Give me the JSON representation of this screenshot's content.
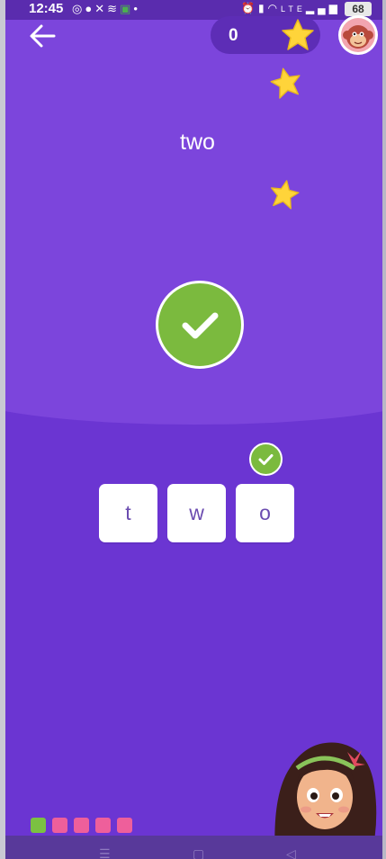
{
  "status_bar": {
    "time": "12:45",
    "left_icons": [
      "whatsapp-icon",
      "chat-icon",
      "missed-call-icon",
      "wifi-calling-icon",
      "sheets-icon",
      "dot-icon"
    ],
    "right_icons": [
      "alarm-icon",
      "vibrate-icon",
      "wifi-icon",
      "volte-icon",
      "signal-icon"
    ],
    "battery": "68"
  },
  "header": {
    "score": "0"
  },
  "quiz": {
    "prompt_word": "two",
    "letters": [
      "t",
      "w",
      "o"
    ]
  },
  "progress": {
    "total": 5,
    "completed": 1,
    "colors": {
      "completed": "#7bc142",
      "pending": "#ee5f9b"
    }
  },
  "colors": {
    "background": "#6b35d2",
    "top_area": "#7c45dc",
    "correct_green": "#7bba3e",
    "star_yellow": "#ffd43a"
  }
}
